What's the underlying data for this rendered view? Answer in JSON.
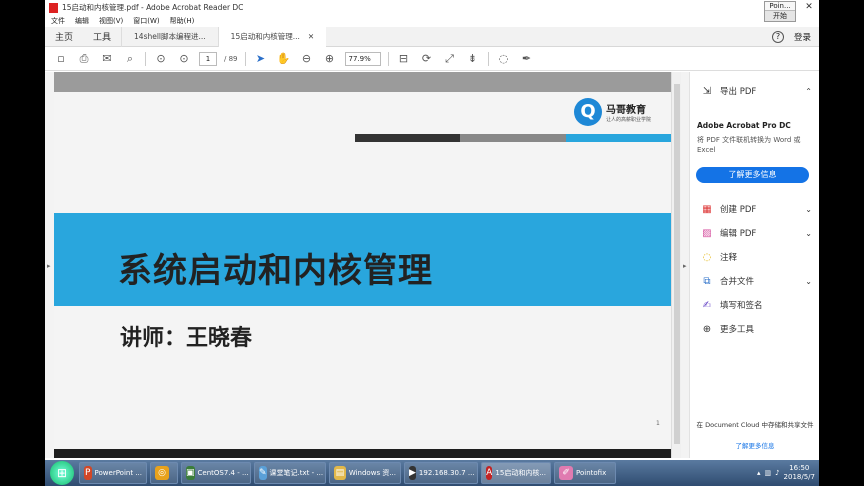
{
  "window": {
    "title": "15启动和内核管理.pdf - Adobe Acrobat Reader DC"
  },
  "pointofix": {
    "title": "Poin...",
    "start": "开始"
  },
  "menu": [
    "文件",
    "编辑",
    "视图(V)",
    "窗口(W)",
    "帮助(H)"
  ],
  "tabs": {
    "home": "主页",
    "tools": "工具",
    "docs": [
      {
        "label": "14shell脚本编程进..."
      },
      {
        "label": "15启动和内核管理..."
      }
    ],
    "login": "登录",
    "help": "?"
  },
  "toolbar": {
    "page_current": "1",
    "page_total": "/ 89",
    "zoom": "77.9%"
  },
  "slide": {
    "logo_glyph": "Q",
    "logo_name": "马哥教育",
    "logo_tagline": "让人的高薪职业学院",
    "title": "系统启动和内核管理",
    "lecturer": "讲师：王晓春",
    "page_number": "1"
  },
  "right_panel": {
    "export_pdf": "导出 PDF",
    "promo_title": "Adobe Acrobat Pro DC",
    "promo_desc": "将 PDF 文件联机转换为 Word 或 Excel",
    "promo_button": "了解更多信息",
    "tools": [
      {
        "label": "创建 PDF",
        "icon": "create-pdf-icon",
        "chevron": true
      },
      {
        "label": "编辑 PDF",
        "icon": "edit-pdf-icon",
        "chevron": true
      },
      {
        "label": "注释",
        "icon": "comment-icon",
        "chevron": false
      },
      {
        "label": "合并文件",
        "icon": "combine-files-icon",
        "chevron": true
      },
      {
        "label": "填写和签名",
        "icon": "fill-sign-icon",
        "chevron": false
      },
      {
        "label": "更多工具",
        "icon": "more-tools-icon",
        "chevron": false
      }
    ],
    "doc_cloud": "在 Document Cloud 中存储和共享文件",
    "doc_cloud_link": "了解更多信息"
  },
  "taskbar": {
    "items": [
      {
        "label": "PowerPoint ...",
        "color": "#d24726",
        "glyph": "P"
      },
      {
        "label": "",
        "color": "#e8a21c",
        "glyph": "◎"
      },
      {
        "label": "CentOS7.4 - ...",
        "color": "#3b7d3b",
        "glyph": "▣"
      },
      {
        "label": "课堂笔记.txt - ...",
        "color": "#5aa0d8",
        "glyph": "✎"
      },
      {
        "label": "Windows 资...",
        "color": "#e2b84a",
        "glyph": "▤"
      },
      {
        "label": "192.168.30.7 ...",
        "color": "#333333",
        "glyph": "▶"
      },
      {
        "label": "15启动和内核...",
        "color": "#c22222",
        "glyph": "A"
      },
      {
        "label": "Pointofix",
        "color": "#e07bb0",
        "glyph": "✐"
      }
    ],
    "time": "16:50",
    "date": "2018/5/7"
  },
  "colors": {
    "accent_blue": "#29a6dd",
    "acrobat_blue": "#1473e6"
  }
}
